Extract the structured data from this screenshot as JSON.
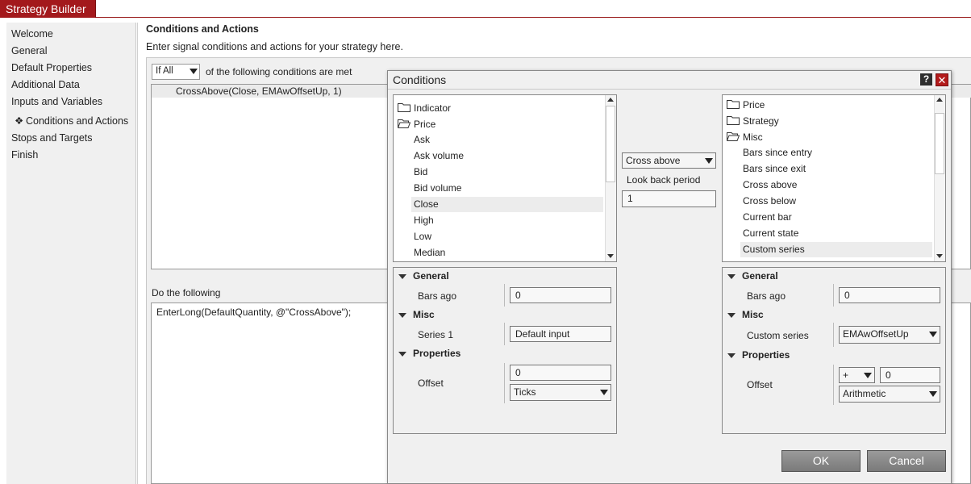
{
  "app": {
    "title": "Strategy Builder"
  },
  "nav": {
    "items": [
      {
        "label": "Welcome"
      },
      {
        "label": "General"
      },
      {
        "label": "Default Properties"
      },
      {
        "label": "Additional Data"
      },
      {
        "label": "Inputs and Variables"
      },
      {
        "label": "Conditions and Actions",
        "active": true,
        "bullet": "❖"
      },
      {
        "label": "Stops and Targets"
      },
      {
        "label": "Finish"
      }
    ]
  },
  "main": {
    "title": "Conditions and Actions",
    "description": "Enter signal conditions and actions for your strategy here.",
    "condition_mode": "If All",
    "condition_mode_suffix": "of the following conditions are met",
    "conditions": [
      "CrossAbove(Close, EMAwOffsetUp, 1)"
    ],
    "actions_label": "Do the following",
    "actions": [
      "EnterLong(DefaultQuantity, @\"CrossAbove\");"
    ]
  },
  "dialog": {
    "title": "Conditions",
    "help_label": "?",
    "close_label": "✕",
    "left_list": {
      "items": [
        {
          "label": "Indicator",
          "folder": true
        },
        {
          "label": "Price",
          "folder": true
        },
        {
          "label": "Ask"
        },
        {
          "label": "Ask volume"
        },
        {
          "label": "Bid"
        },
        {
          "label": "Bid volume"
        },
        {
          "label": "Close",
          "selected": true
        },
        {
          "label": "High"
        },
        {
          "label": "Low"
        },
        {
          "label": "Median"
        }
      ]
    },
    "operator": {
      "value": "Cross above",
      "lookback_label": "Look back period",
      "lookback_value": "1"
    },
    "right_list": {
      "items": [
        {
          "label": "Price",
          "folder": true
        },
        {
          "label": "Strategy",
          "folder": true
        },
        {
          "label": "Misc",
          "folder": true
        },
        {
          "label": "Bars since entry"
        },
        {
          "label": "Bars since exit"
        },
        {
          "label": "Cross above"
        },
        {
          "label": "Cross below"
        },
        {
          "label": "Current bar"
        },
        {
          "label": "Current state"
        },
        {
          "label": "Custom series",
          "selected": true
        }
      ]
    },
    "left_props": {
      "general_label": "General",
      "bars_ago_label": "Bars ago",
      "bars_ago_value": "0",
      "misc_label": "Misc",
      "series_label": "Series 1",
      "series_value": "Default input",
      "properties_label": "Properties",
      "offset_label": "Offset",
      "offset_value": "0",
      "offset_type": "Ticks"
    },
    "right_props": {
      "general_label": "General",
      "bars_ago_label": "Bars ago",
      "bars_ago_value": "0",
      "misc_label": "Misc",
      "custom_series_label": "Custom series",
      "custom_series_value": "EMAwOffsetUp",
      "properties_label": "Properties",
      "offset_label": "Offset",
      "offset_sign": "+",
      "offset_value": "0",
      "offset_type": "Arithmetic"
    },
    "ok_label": "OK",
    "cancel_label": "Cancel"
  },
  "colors": {
    "brand": "#a3191c",
    "panel": "#f0f0f0",
    "button": "#8a8a8a"
  }
}
